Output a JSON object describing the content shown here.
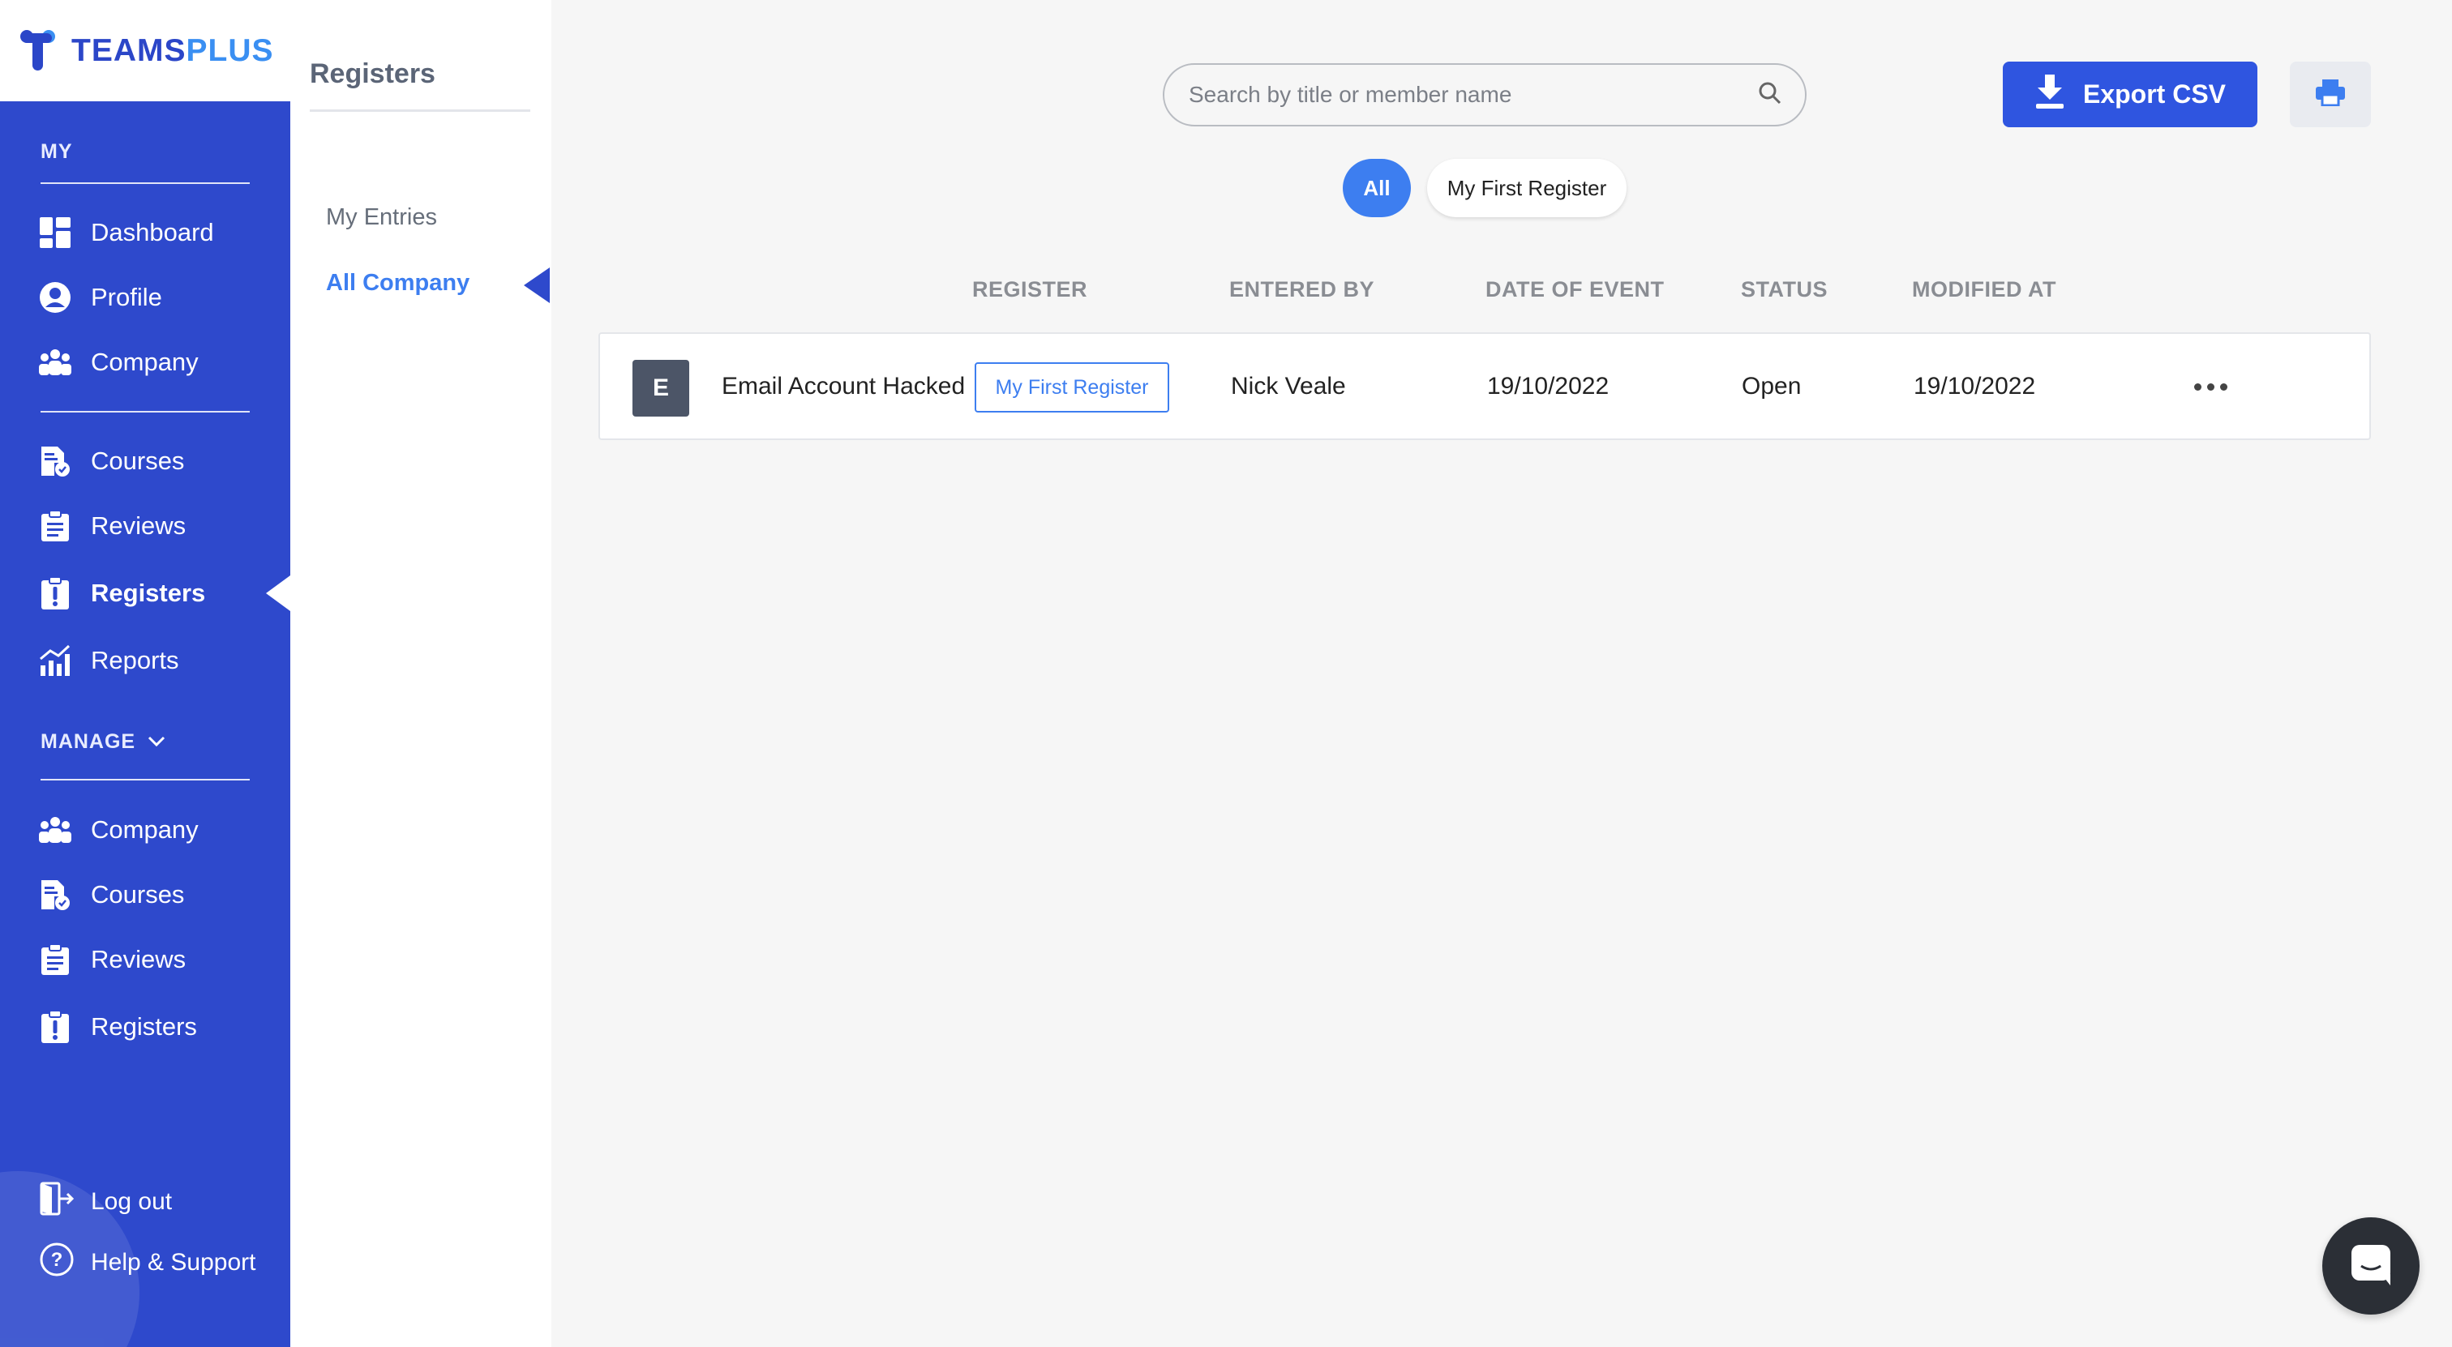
{
  "brand": {
    "name_part1": "TEAMS",
    "name_part2": "PLUS",
    "primary_color": "#2e49cc",
    "accent_color": "#3d7ef0"
  },
  "sidebar": {
    "my_label": "MY",
    "my_items": [
      {
        "label": "Dashboard",
        "icon": "dashboard-icon"
      },
      {
        "label": "Profile",
        "icon": "profile-icon"
      },
      {
        "label": "Company",
        "icon": "company-icon"
      },
      {
        "label": "Courses",
        "icon": "courses-icon"
      },
      {
        "label": "Reviews",
        "icon": "reviews-icon"
      },
      {
        "label": "Registers",
        "icon": "registers-icon",
        "active": true
      },
      {
        "label": "Reports",
        "icon": "reports-icon"
      }
    ],
    "manage_label": "MANAGE",
    "manage_items": [
      {
        "label": "Company",
        "icon": "company-icon"
      },
      {
        "label": "Courses",
        "icon": "courses-icon"
      },
      {
        "label": "Reviews",
        "icon": "reviews-icon"
      },
      {
        "label": "Registers",
        "icon": "registers-icon"
      }
    ],
    "logout_label": "Log out",
    "help_label": "Help & Support"
  },
  "subpanel": {
    "title": "Registers",
    "links": [
      {
        "label": "My Entries"
      },
      {
        "label": "All Company",
        "active": true
      }
    ]
  },
  "toolbar": {
    "search_placeholder": "Search by title or member name",
    "search_value": "",
    "export_label": "Export CSV",
    "print_icon": "printer-icon"
  },
  "filters": [
    {
      "label": "All",
      "active": true
    },
    {
      "label": "My First Register"
    }
  ],
  "table": {
    "columns": [
      "REGISTER",
      "ENTERED BY",
      "DATE OF EVENT",
      "STATUS",
      "MODIFIED AT"
    ],
    "rows": [
      {
        "avatar_letter": "E",
        "title": "Email Account Hacked",
        "register": "My First Register",
        "entered_by": "Nick Veale",
        "date_of_event": "19/10/2022",
        "status": "Open",
        "modified_at": "19/10/2022"
      }
    ]
  }
}
